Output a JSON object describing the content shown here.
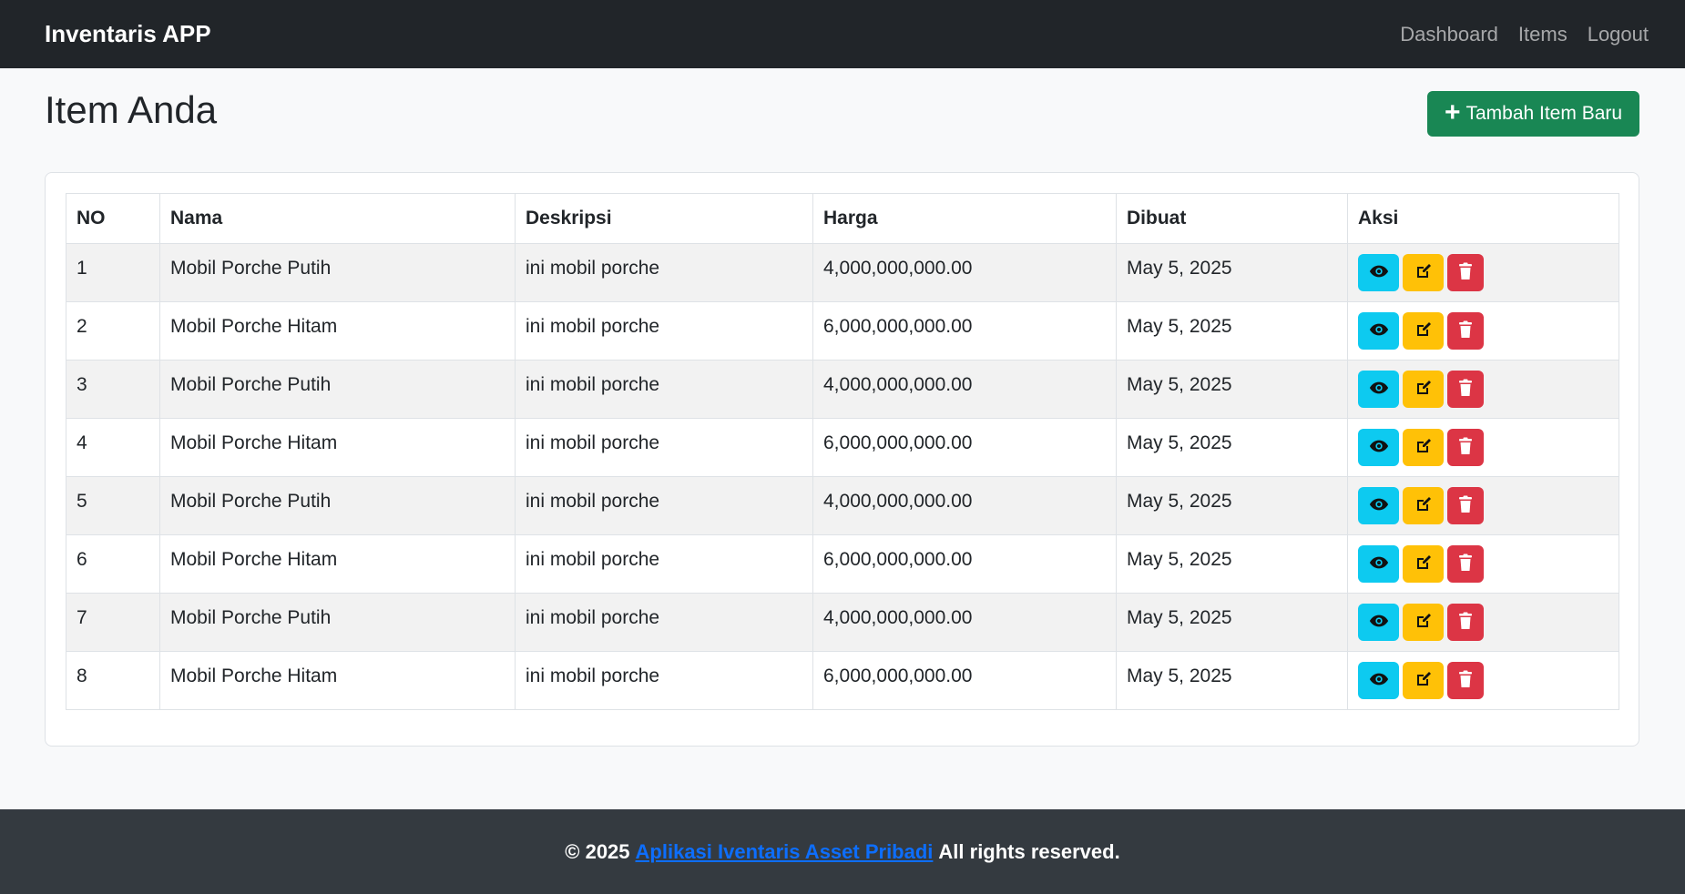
{
  "navbar": {
    "brand": "Inventaris APP",
    "links": [
      "Dashboard",
      "Items",
      "Logout"
    ]
  },
  "page": {
    "title": "Item Anda",
    "add_button": "Tambah Item Baru",
    "add_icon": "plus-icon"
  },
  "table": {
    "headers": [
      "NO",
      "Nama",
      "Deskripsi",
      "Harga",
      "Dibuat",
      "Aksi"
    ],
    "rows": [
      [
        "1",
        "Mobil Porche Putih",
        "ini mobil porche",
        "4,000,000,000.00",
        "May 5, 2025"
      ],
      [
        "2",
        "Mobil Porche Hitam",
        "ini mobil porche",
        "6,000,000,000.00",
        "May 5, 2025"
      ],
      [
        "3",
        "Mobil Porche Putih",
        "ini mobil porche",
        "4,000,000,000.00",
        "May 5, 2025"
      ],
      [
        "4",
        "Mobil Porche Hitam",
        "ini mobil porche",
        "6,000,000,000.00",
        "May 5, 2025"
      ],
      [
        "5",
        "Mobil Porche Putih",
        "ini mobil porche",
        "4,000,000,000.00",
        "May 5, 2025"
      ],
      [
        "6",
        "Mobil Porche Hitam",
        "ini mobil porche",
        "6,000,000,000.00",
        "May 5, 2025"
      ],
      [
        "7",
        "Mobil Porche Putih",
        "ini mobil porche",
        "4,000,000,000.00",
        "May 5, 2025"
      ],
      [
        "8",
        "Mobil Porche Hitam",
        "ini mobil porche",
        "6,000,000,000.00",
        "May 5, 2025"
      ]
    ],
    "action_icons": [
      "eye-icon",
      "edit-icon",
      "trash-icon"
    ]
  },
  "footer": {
    "prefix": "© 2025",
    "link": "Aplikasi Iventaris Asset Pribadi",
    "suffix": "All rights reserved."
  },
  "colors": {
    "navbar": "#212529",
    "success": "#198754",
    "info": "#0dcaf0",
    "warning": "#ffc107",
    "danger": "#dc3545",
    "footer": "#343a40",
    "link": "#0d6efd"
  }
}
